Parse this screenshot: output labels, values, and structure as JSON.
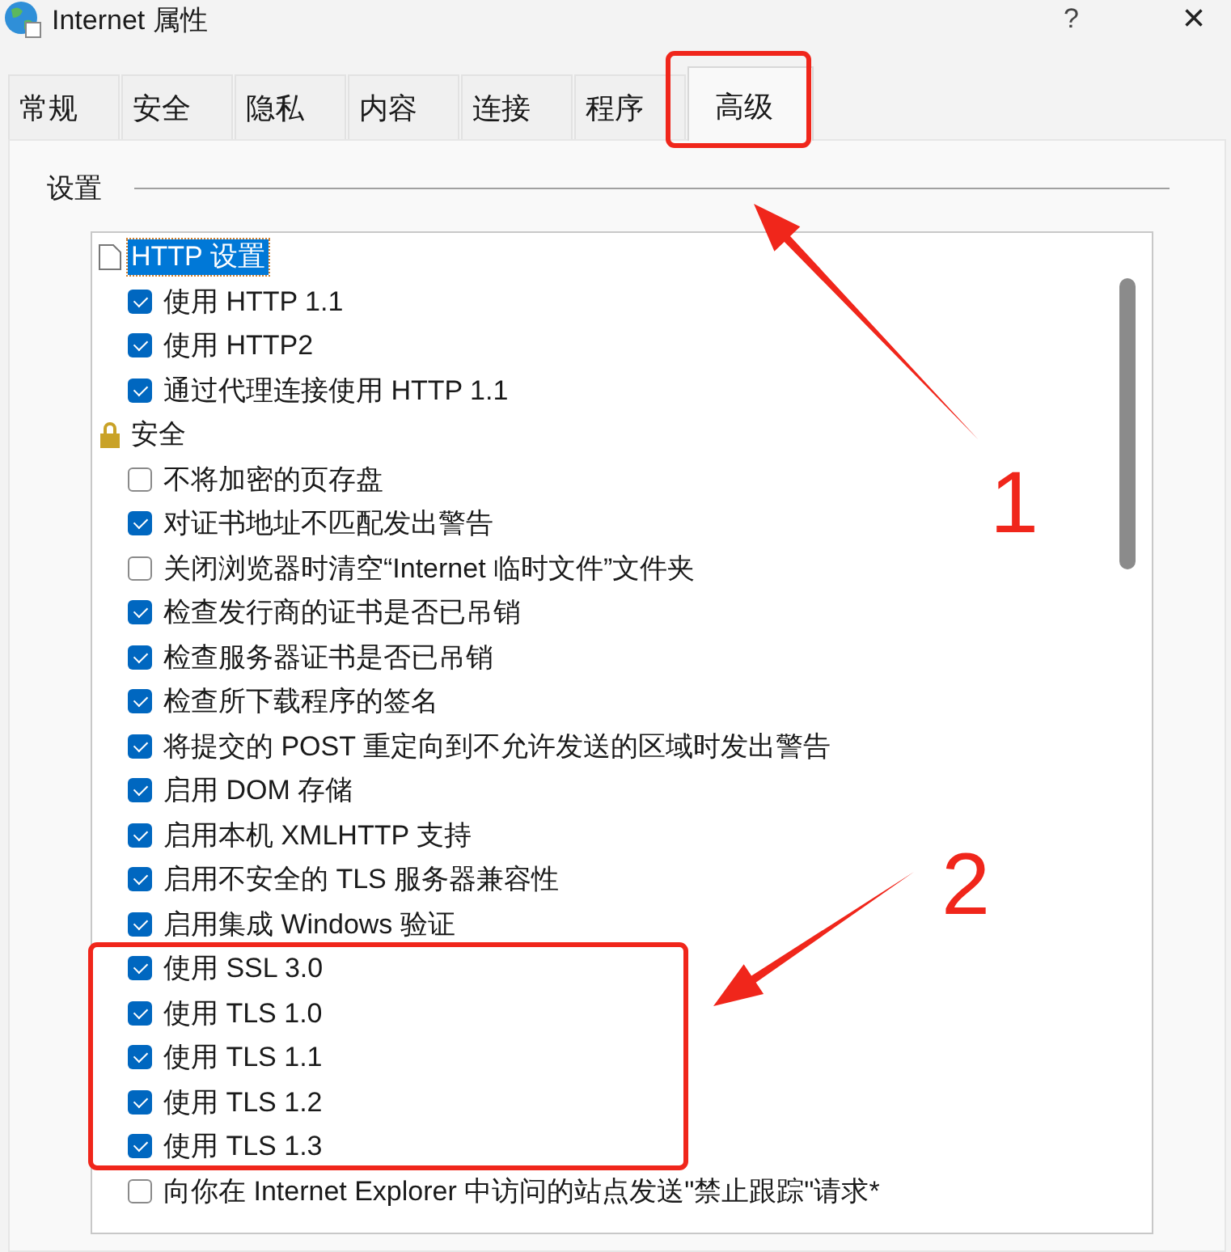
{
  "window": {
    "title": "Internet 属性",
    "help": "?",
    "close": "×"
  },
  "tabs": [
    {
      "label": "常规",
      "selected": false
    },
    {
      "label": "安全",
      "selected": false
    },
    {
      "label": "隐私",
      "selected": false
    },
    {
      "label": "内容",
      "selected": false
    },
    {
      "label": "连接",
      "selected": false
    },
    {
      "label": "程序",
      "selected": false
    },
    {
      "label": "高级",
      "selected": true
    }
  ],
  "settings": {
    "label": "设置",
    "groups": [
      {
        "label": "HTTP 设置",
        "kind": "page",
        "selected": true,
        "children": [
          {
            "label": "使用 HTTP 1.1",
            "checked": true
          },
          {
            "label": "使用 HTTP2",
            "checked": true
          },
          {
            "label": "通过代理连接使用 HTTP 1.1",
            "checked": true
          }
        ]
      },
      {
        "label": "安全",
        "kind": "lock",
        "selected": false,
        "children": [
          {
            "label": "不将加密的页存盘",
            "checked": false
          },
          {
            "label": "对证书地址不匹配发出警告",
            "checked": true
          },
          {
            "label": "关闭浏览器时清空“Internet 临时文件”文件夹",
            "checked": false
          },
          {
            "label": "检查发行商的证书是否已吊销",
            "checked": true
          },
          {
            "label": "检查服务器证书是否已吊销",
            "checked": true
          },
          {
            "label": "检查所下载程序的签名",
            "checked": true
          },
          {
            "label": "将提交的 POST 重定向到不允许发送的区域时发出警告",
            "checked": true
          },
          {
            "label": "启用 DOM 存储",
            "checked": true
          },
          {
            "label": "启用本机 XMLHTTP 支持",
            "checked": true
          },
          {
            "label": "启用不安全的 TLS 服务器兼容性",
            "checked": true
          },
          {
            "label": "启用集成 Windows 验证",
            "checked": true
          },
          {
            "label": "使用 SSL 3.0",
            "checked": true
          },
          {
            "label": "使用 TLS 1.0",
            "checked": true
          },
          {
            "label": "使用 TLS 1.1",
            "checked": true
          },
          {
            "label": "使用 TLS 1.2",
            "checked": true
          },
          {
            "label": "使用 TLS 1.3",
            "checked": true
          },
          {
            "label": "向你在 Internet Explorer 中访问的站点发送\"禁止跟踪\"请求*",
            "checked": false
          }
        ]
      }
    ]
  },
  "annotations": [
    {
      "label": "1"
    },
    {
      "label": "2"
    }
  ]
}
